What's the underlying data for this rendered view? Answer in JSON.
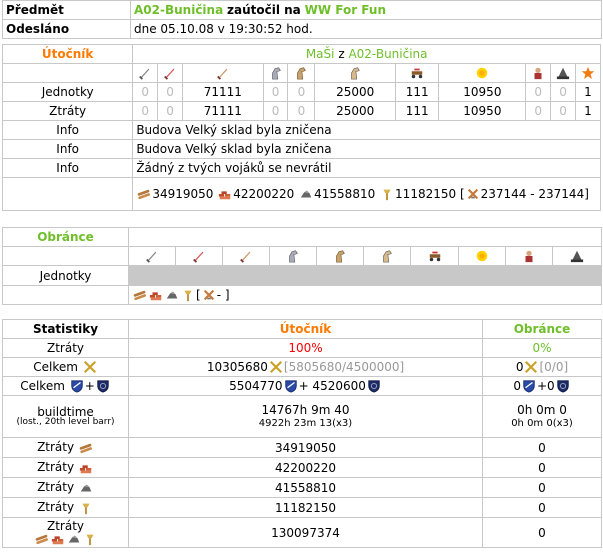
{
  "header": {
    "subject_label": "Předmět",
    "subject_village": "A02-Buničina",
    "subject_mid": "zaútočil na",
    "subject_target": "WW For Fun",
    "sent_label": "Odesláno",
    "sent_value": "dne 05.10.08 v 19:30:52 hod."
  },
  "attacker": {
    "label": "Útočník",
    "player": "MaŠi",
    "from": "z",
    "village": "A02-Buničina",
    "units_label": "Jednotky",
    "units": [
      "0",
      "0",
      "71111",
      "0",
      "0",
      "25000",
      "111",
      "10950",
      "0",
      "0",
      "1"
    ],
    "losses_label": "Ztráty",
    "losses": [
      "0",
      "0",
      "71111",
      "0",
      "0",
      "25000",
      "111",
      "10950",
      "0",
      "0",
      "1"
    ],
    "info_label": "Info",
    "info": [
      "Budova Velký sklad byla zničena",
      "Budova Velký sklad byla zničena",
      "Žádný z tvých vojáků se nevrátil"
    ],
    "bounty_wood": "34919050",
    "bounty_clay": "42200220",
    "bounty_iron": "41558810",
    "bounty_crop": "11182150 [",
    "bounty_total": "237144 - 237144]"
  },
  "defender": {
    "label": "Obránce",
    "units_label": "Jednotky",
    "resources_tail": "[",
    "resources_end": "- ]"
  },
  "unit_icons": [
    "sword-icon",
    "sword-icon",
    "sword-icon",
    "horse-icon",
    "horse-icon",
    "horse-icon",
    "ram-icon",
    "catapult-icon",
    "chief-icon",
    "settler-icon",
    "hero-icon"
  ],
  "stats": {
    "title": "Statistiky",
    "attacker_label": "Útočník",
    "defender_label": "Obránce",
    "rows": {
      "losses_label": "Ztráty",
      "losses_att": "100%",
      "losses_def": "0%",
      "total1_label": "Celkem",
      "total1_att": "10305680",
      "total1_att_bracket": "[5805680/4500000]",
      "total1_def": "0",
      "total1_def_bracket": "[0/0]",
      "total2_label": "Celkem",
      "total2_plus": "+",
      "total2_att_a": "5504770",
      "total2_att_plus": "+ 4520600",
      "total2_def_a": "0",
      "total2_def_plus": "+0",
      "build_label": "buildtime",
      "build_sub": "(lost., 20th level barr)",
      "build_att": "14767h 9m 40",
      "build_att_x3": "4922h 23m 13(x3)",
      "build_def": "0h 0m 0",
      "build_def_x3": "0h 0m 0(x3)",
      "res": [
        {
          "label": "Ztráty",
          "att": "34919050",
          "def": "0"
        },
        {
          "label": "Ztráty",
          "att": "42200220",
          "def": "0"
        },
        {
          "label": "Ztráty",
          "att": "41558810",
          "def": "0"
        },
        {
          "label": "Ztráty",
          "att": "11182150",
          "def": "0"
        }
      ],
      "sum_label": "Ztráty",
      "sum_att": "130097374",
      "sum_def": "0"
    }
  },
  "colors": {
    "green": "#6fbf2a",
    "orange": "#ff7a00",
    "red": "#ff0000",
    "grid": "#c8c8c8"
  }
}
